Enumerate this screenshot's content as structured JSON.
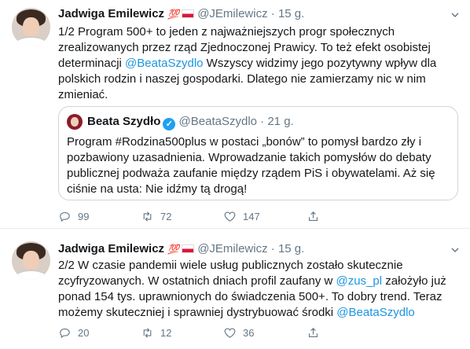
{
  "tweets": [
    {
      "author_name": "Jadwiga Emilewicz",
      "emoji": "💯",
      "handle": "@JEmilewicz",
      "separator": "·",
      "time": "15 g.",
      "text_parts": [
        "1/2 Program 500+ to jeden z najważniejszych progr społecznych zrealizowanych przez rząd Zjednoczonej Prawicy. To też efekt osobistej determinacji ",
        "@BeataSzydlo",
        " Wszyscy widzimy jego pozytywny wpływ dla polskich rodzin i naszej gospodarki. Dlatego nie zamierzamy nic w nim zmieniać."
      ],
      "quote": {
        "author_name": "Beata Szydło",
        "verified": "✓",
        "handle": "@BeataSzydlo",
        "separator": "·",
        "time": "21 g.",
        "text": "Program #Rodzina500plus w postaci „bonów” to pomysł bardzo zły i pozbawiony uzasadnienia. Wprowadzanie takich pomysłów do debaty publicznej podważa zaufanie między rządem PiS i obywatelami. Aż się ciśnie na usta: Nie idźmy tą drogą!"
      },
      "replies": "99",
      "retweets": "72",
      "likes": "147"
    },
    {
      "author_name": "Jadwiga Emilewicz",
      "emoji": "💯",
      "handle": "@JEmilewicz",
      "separator": "·",
      "time": "15 g.",
      "text_parts": [
        "2/2 W czasie pandemii wiele usług publicznych zostało skutecznie zcyfryzowanych. W ostatnich dniach profil zaufany w ",
        "@zus_pl",
        " założyło już ponad 154 tys. uprawnionych do świadczenia 500+. To dobry trend. Teraz możemy skuteczniej i sprawniej dystrybuować środki ",
        "@BeataSzydlo"
      ],
      "replies": "20",
      "retweets": "12",
      "likes": "36"
    }
  ],
  "colors": {
    "link": "#1b95e0",
    "muted": "#657786",
    "text": "#14171a",
    "border": "#e6ecf0"
  },
  "icons": {
    "reply": "reply-icon",
    "retweet": "retweet-icon",
    "like": "heart-icon",
    "share": "share-icon",
    "menu": "chevron-down-icon"
  }
}
